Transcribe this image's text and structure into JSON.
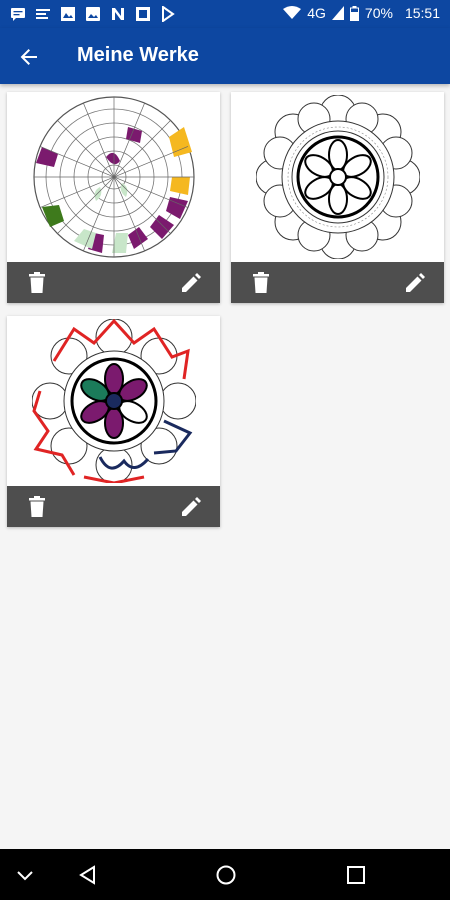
{
  "status_bar": {
    "network": "4G",
    "battery": "70%",
    "time": "15:51",
    "left_icons": [
      "message-icon",
      "notes-icon",
      "image-icon",
      "image-icon",
      "n-icon",
      "image-icon",
      "play-store-icon"
    ]
  },
  "app_bar": {
    "title": "Meine Werke",
    "back_icon": "arrow-back-icon",
    "color": "#0d47a1"
  },
  "works": [
    {
      "name": "mandala-1",
      "state": "partially-colored",
      "colors": [
        "#7b1a6e",
        "#f5b820",
        "#3e7a1c",
        "#c8e6c9"
      ]
    },
    {
      "name": "mandala-2",
      "state": "uncolored",
      "colors": []
    },
    {
      "name": "mandala-3",
      "state": "partially-colored",
      "colors": [
        "#e02424",
        "#7b1a6e",
        "#1b7b5a",
        "#1a2a5e"
      ]
    }
  ],
  "card_actions": {
    "delete_icon": "trash-icon",
    "edit_icon": "pencil-icon"
  },
  "nav_bar": [
    "chevron-down-icon",
    "back-triangle-icon",
    "home-circle-icon",
    "recents-square-icon"
  ]
}
